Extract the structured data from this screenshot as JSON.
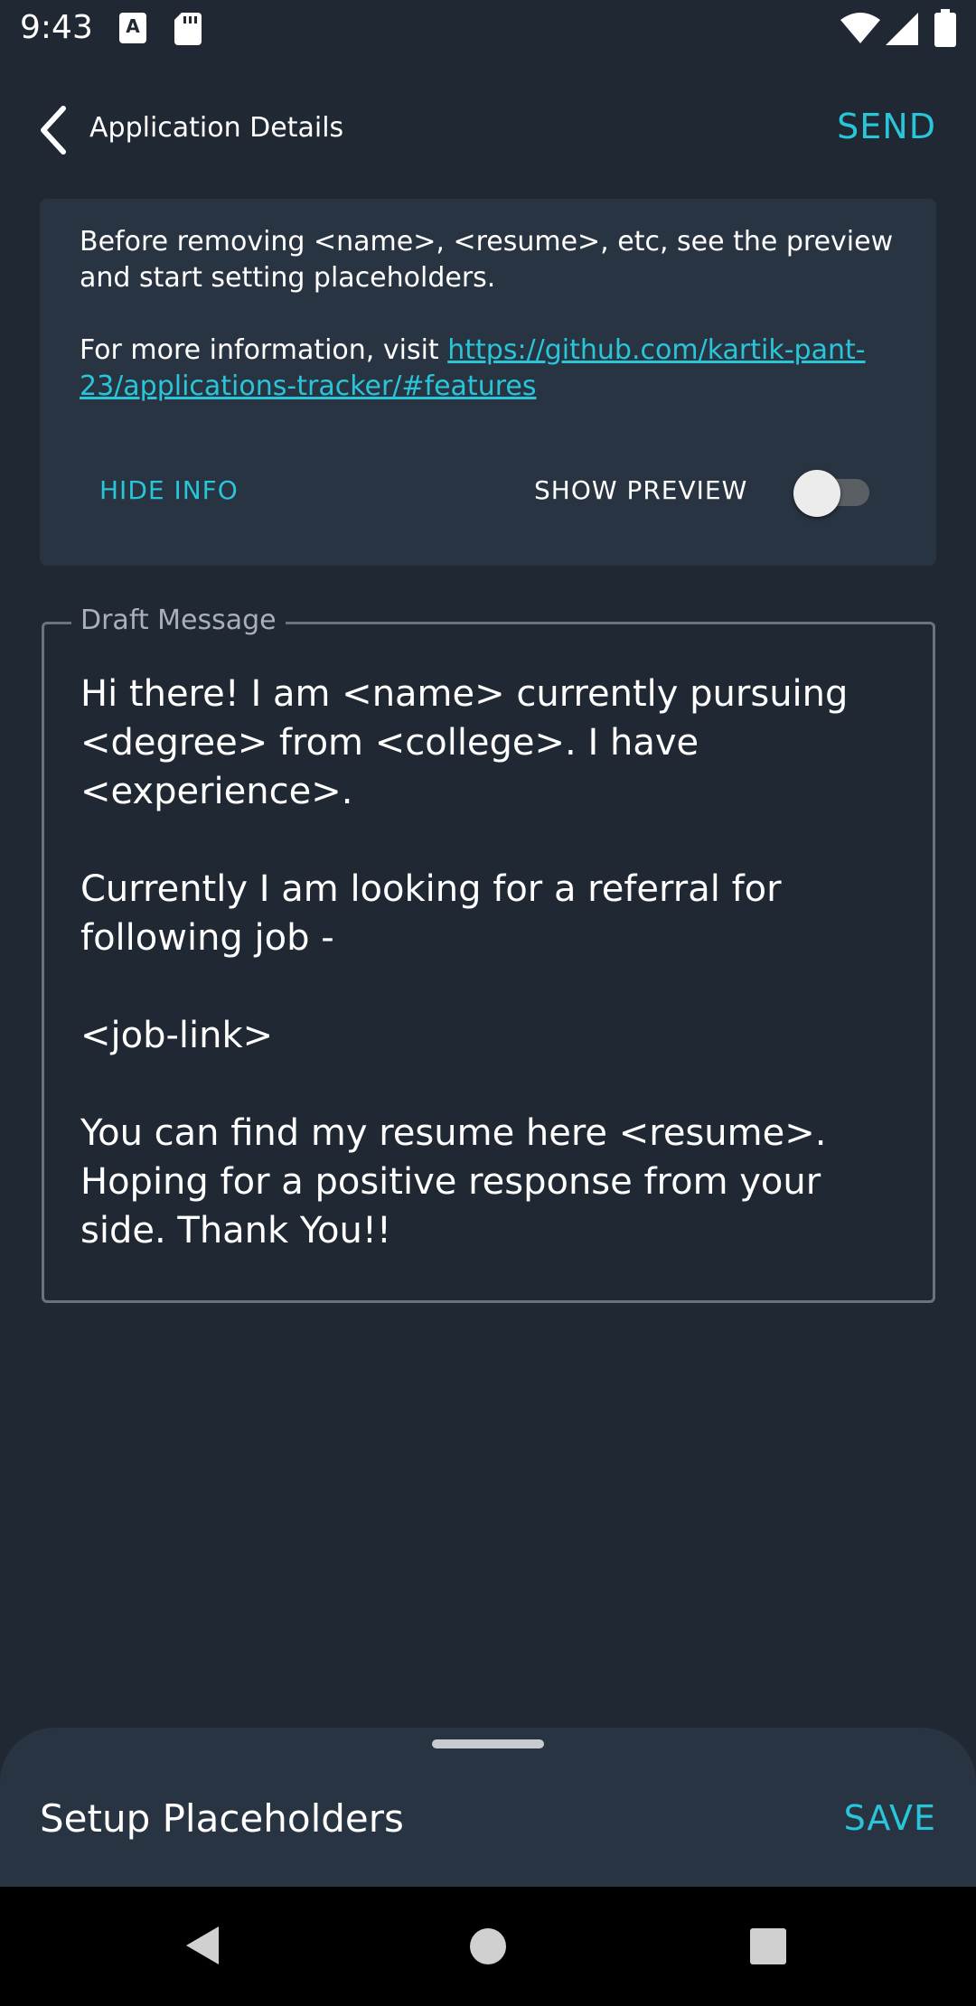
{
  "status_bar": {
    "time": "9:43",
    "icons": [
      "a-notification-icon",
      "sd-card-icon",
      "wifi-icon",
      "signal-icon",
      "battery-icon"
    ]
  },
  "app_bar": {
    "title": "Application Details",
    "send_label": "SEND"
  },
  "info_card": {
    "line1": "Before removing <name>, <resume>, etc, see the preview and start setting placeholders.",
    "line2_prefix": "For more information, visit ",
    "link_text": "https://github.com/kartik-pant-23/applications-tracker/#features",
    "hide_label": "HIDE INFO",
    "preview_label": "SHOW PREVIEW",
    "preview_enabled": false
  },
  "draft": {
    "label": "Draft Message",
    "text": "Hi there! I am <name> currently pursuing <degree> from <college>. I have <experience>.\n\nCurrently I am looking for a referral for following job -\n\n<job-link>\n\nYou can find my resume here <resume>. Hoping for a positive response from your side. Thank You!!"
  },
  "bottom_sheet": {
    "title": "Setup Placeholders",
    "save_label": "SAVE"
  },
  "colors": {
    "background": "#202833",
    "card": "#293442",
    "accent": "#29c5d8",
    "nav_bar": "#000000"
  }
}
